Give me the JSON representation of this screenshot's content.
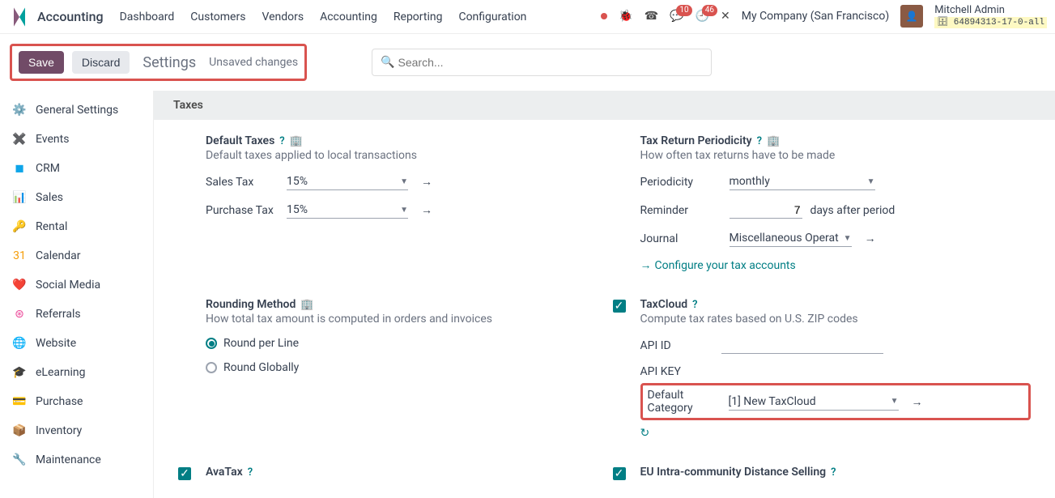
{
  "brand": "Accounting",
  "topnav": [
    "Dashboard",
    "Customers",
    "Vendors",
    "Accounting",
    "Reporting",
    "Configuration"
  ],
  "badges": {
    "msg": "10",
    "activity": "46"
  },
  "company": "My Company (San Francisco)",
  "user": {
    "name": "Mitchell Admin",
    "db": "64894313-17-0-all"
  },
  "cp": {
    "save": "Save",
    "discard": "Discard",
    "title": "Settings",
    "unsaved": "Unsaved changes",
    "search_placeholder": "Search..."
  },
  "sidebar": [
    {
      "icon": "⚙️",
      "label": "General Settings"
    },
    {
      "icon": "✖️",
      "label": "Events",
      "iconColor": "#f97316"
    },
    {
      "icon": "◼",
      "label": "CRM",
      "iconColor": "#0ea5e9"
    },
    {
      "icon": "📊",
      "label": "Sales"
    },
    {
      "icon": "🔑",
      "label": "Rental"
    },
    {
      "icon": "31",
      "label": "Calendar",
      "iconColor": "#f59e0b"
    },
    {
      "icon": "❤️",
      "label": "Social Media"
    },
    {
      "icon": "⊛",
      "label": "Referrals",
      "iconColor": "#ec4899"
    },
    {
      "icon": "🌐",
      "label": "Website"
    },
    {
      "icon": "🎓",
      "label": "eLearning"
    },
    {
      "icon": "💳",
      "label": "Purchase"
    },
    {
      "icon": "📦",
      "label": "Inventory"
    },
    {
      "icon": "🔧",
      "label": "Maintenance"
    }
  ],
  "section": {
    "title": "Taxes"
  },
  "default_taxes": {
    "title": "Default Taxes",
    "desc": "Default taxes applied to local transactions",
    "sales_label": "Sales Tax",
    "sales_value": "15%",
    "purchase_label": "Purchase Tax",
    "purchase_value": "15%"
  },
  "tax_return": {
    "title": "Tax Return Periodicity",
    "desc": "How often tax returns have to be made",
    "periodicity_label": "Periodicity",
    "periodicity_value": "monthly",
    "reminder_label": "Reminder",
    "reminder_value": "7",
    "reminder_suffix": "days after period",
    "journal_label": "Journal",
    "journal_value": "Miscellaneous Operat",
    "configure_link": "Configure your tax accounts"
  },
  "rounding": {
    "title": "Rounding Method",
    "desc": "How total tax amount is computed in orders and invoices",
    "opt1": "Round per Line",
    "opt2": "Round Globally"
  },
  "taxcloud": {
    "title": "TaxCloud",
    "desc": "Compute tax rates based on U.S. ZIP codes",
    "api_id_label": "API ID",
    "api_key_label": "API KEY",
    "default_cat_label": "Default Category",
    "default_cat_value": "[1] New TaxCloud"
  },
  "avatax": {
    "title": "AvaTax"
  },
  "eu_distance": {
    "title": "EU Intra-community Distance Selling"
  }
}
